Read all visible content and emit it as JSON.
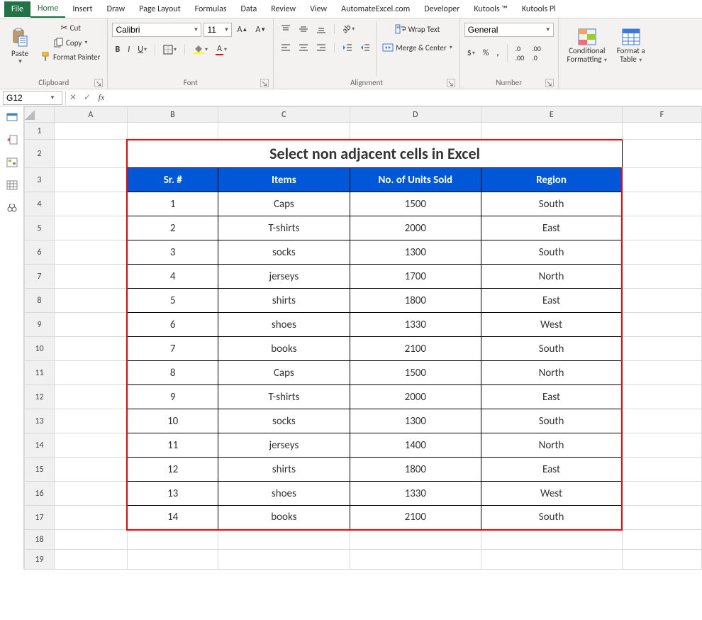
{
  "tabs": {
    "file": "File",
    "home": "Home",
    "insert": "Insert",
    "draw": "Draw",
    "pageLayout": "Page Layout",
    "formulas": "Formulas",
    "data": "Data",
    "review": "Review",
    "view": "View",
    "automate": "AutomateExcel.com",
    "developer": "Developer",
    "kutools": "Kutools ™",
    "kutoolsPlus": "Kutools Pl"
  },
  "ribbon": {
    "clipboard": {
      "paste": "Paste",
      "cut": "Cut",
      "copy": "Copy",
      "formatPainter": "Format Painter",
      "label": "Clipboard"
    },
    "font": {
      "name": "Calibri",
      "size": "11",
      "label": "Font"
    },
    "alignment": {
      "wrap": "Wrap Text",
      "merge": "Merge & Center",
      "label": "Alignment"
    },
    "number": {
      "format": "General",
      "label": "Number"
    },
    "styles": {
      "conditional": "Conditional",
      "formatting": "Formatting",
      "formatAs": "Format a",
      "table": "Table"
    }
  },
  "namebox": "G12",
  "formula": "",
  "columns": [
    "A",
    "B",
    "C",
    "D",
    "E",
    "F"
  ],
  "rowLabels": [
    "1",
    "2",
    "3",
    "4",
    "5",
    "6",
    "7",
    "8",
    "9",
    "10",
    "11",
    "12",
    "13",
    "14",
    "15",
    "16",
    "17",
    "18",
    "19"
  ],
  "title": "Select non adjacent cells in Excel",
  "headers": {
    "sr": "Sr. #",
    "items": "Items",
    "units": "No. of Units Sold",
    "region": "Region"
  },
  "rows": [
    {
      "sr": "1",
      "item": "Caps",
      "units": "1500",
      "region": "South"
    },
    {
      "sr": "2",
      "item": "T-shirts",
      "units": "2000",
      "region": "East"
    },
    {
      "sr": "3",
      "item": "socks",
      "units": "1300",
      "region": "South"
    },
    {
      "sr": "4",
      "item": "jerseys",
      "units": "1700",
      "region": "North"
    },
    {
      "sr": "5",
      "item": "shirts",
      "units": "1800",
      "region": "East"
    },
    {
      "sr": "6",
      "item": "shoes",
      "units": "1330",
      "region": "West"
    },
    {
      "sr": "7",
      "item": "books",
      "units": "2100",
      "region": "South"
    },
    {
      "sr": "8",
      "item": "Caps",
      "units": "1500",
      "region": "North"
    },
    {
      "sr": "9",
      "item": "T-shirts",
      "units": "2000",
      "region": "East"
    },
    {
      "sr": "10",
      "item": "socks",
      "units": "1300",
      "region": "South"
    },
    {
      "sr": "11",
      "item": "jerseys",
      "units": "1400",
      "region": "North"
    },
    {
      "sr": "12",
      "item": "shirts",
      "units": "1800",
      "region": "East"
    },
    {
      "sr": "13",
      "item": "shoes",
      "units": "1330",
      "region": "West"
    },
    {
      "sr": "14",
      "item": "books",
      "units": "2100",
      "region": "South"
    }
  ]
}
